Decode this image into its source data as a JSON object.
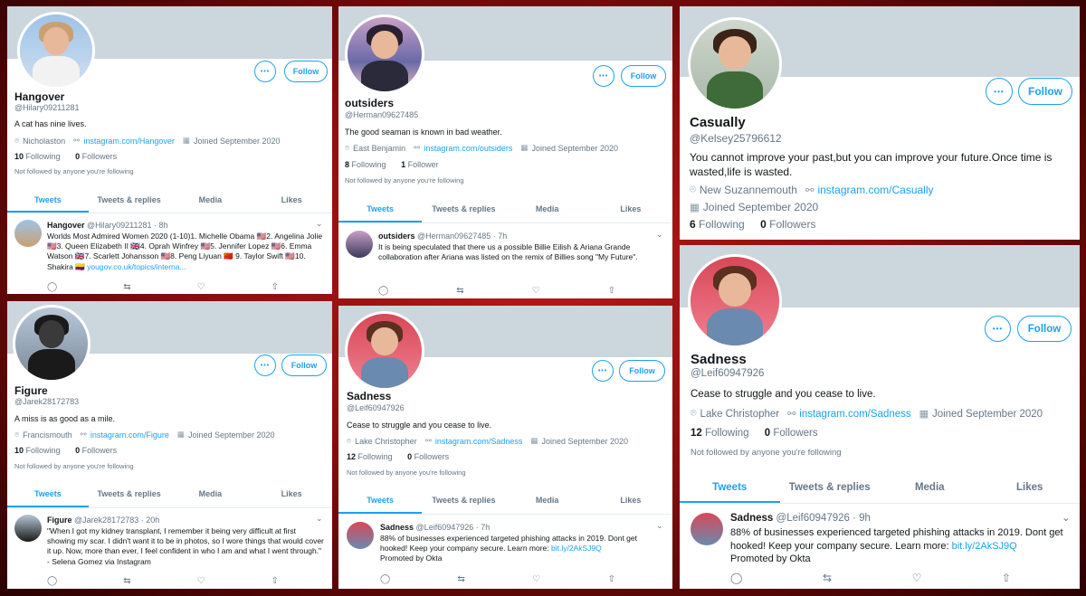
{
  "follow_label": "Follow",
  "more_label": "•••",
  "tabs": [
    "Tweets",
    "Tweets & replies",
    "Media",
    "Likes"
  ],
  "not_followed": "Not followed by anyone you're following",
  "icons": {
    "location": "location-pin-icon",
    "link": "link-icon",
    "calendar": "calendar-icon",
    "reply": "reply-icon",
    "retweet": "retweet-icon",
    "like": "heart-icon",
    "share": "share-icon",
    "chevron": "chevron-down-icon"
  },
  "colors": {
    "accent": "#1da1f2",
    "banner": "#ccd6dd",
    "muted": "#657786"
  },
  "cards": [
    {
      "name": "Hangover",
      "handle": "@Hilary09211281",
      "bio": "A cat has nine lives.",
      "location": "Nicholaston",
      "url": "instagram.com/Hangover",
      "joined": "Joined September 2020",
      "following": "10",
      "following_label": "Following",
      "followers": "0",
      "followers_label": "Followers",
      "tweet": {
        "name": "Hangover",
        "handle": "@Hilary09211281",
        "time": "· 8h",
        "text": "Worlds Most Admired Women 2020 (1-10)1. Michelle Obama 🇺🇸2. Angelina Jolie 🇺🇸3. Queen Elizabeth II 🇬🇧4. Oprah Winfrey 🇺🇸5. Jennifer Lopez 🇺🇸6. Emma Watson 🇬🇧7. Scarlett Johansson 🇺🇸8. Peng Liyuan 🇨🇳 9. Taylor Swift 🇺🇸10. Shakira 🇨🇴 ",
        "link": "yougov.co.uk/topics/interna..."
      }
    },
    {
      "name": "outsiders",
      "handle": "@Herman09627485",
      "bio": "The good seaman is known in bad weather.",
      "location": "East Benjamin",
      "url": "instagram.com/outsiders",
      "joined": "Joined September 2020",
      "following": "8",
      "following_label": "Following",
      "followers": "1",
      "followers_label": "Follower",
      "tweet": {
        "name": "outsiders",
        "handle": "@Herman09627485",
        "time": "· 7h",
        "text": "It is being speculated that there us a possible Billie Eilish & Ariana Grande collaboration after Ariana was listed on the remix of Billies song \"My Future\".",
        "link": ""
      }
    },
    {
      "name": "Casually",
      "handle": "@Kelsey25796612",
      "bio": "You cannot improve your past,but you can improve your future.Once time is wasted,life is wasted.",
      "location": "New Suzannemouth",
      "url": "instagram.com/Casually",
      "joined": "Joined September 2020",
      "following": "6",
      "following_label": "Following",
      "followers": "0",
      "followers_label": "Followers"
    },
    {
      "name": "Figure",
      "handle": "@Jarek28172783",
      "bio": "A miss is as good as a mile.",
      "location": "Francismouth",
      "url": "instagram.com/Figure",
      "joined": "Joined September 2020",
      "following": "10",
      "following_label": "Following",
      "followers": "0",
      "followers_label": "Followers",
      "tweet": {
        "name": "Figure",
        "handle": "@Jarek28172783",
        "time": "· 20h",
        "text": "\"When I got my kidney transplant, I remember it being very difficult at first showing my scar. I didn't want it to be in photos, so I wore things that would cover it up. Now, more than ever, I feel confident in who I am and what I went through.\" - Selena Gomez via Instagram",
        "link": ""
      }
    },
    {
      "name": "Sadness",
      "handle": "@Leif60947926",
      "bio": "Cease to struggle and you cease to live.",
      "location": "Lake Christopher",
      "url": "instagram.com/Sadness",
      "joined": "Joined September 2020",
      "following": "12",
      "following_label": "Following",
      "followers": "0",
      "followers_label": "Followers",
      "tweet": {
        "name": "Sadness",
        "handle": "@Leif60947926",
        "time": "· 7h",
        "text": "88% of businesses experienced targeted phishing attacks in 2019. Dont get hooked! Keep your company secure. Learn more: ",
        "link": "bit.ly/2AkSJ9Q",
        "promo": "Promoted by Okta"
      }
    },
    {
      "name": "Sadness",
      "handle": "@Leif60947926",
      "bio": "Cease to struggle and you cease to live.",
      "location": "Lake Christopher",
      "url": "instagram.com/Sadness",
      "joined": "Joined September 2020",
      "following": "12",
      "following_label": "Following",
      "followers": "0",
      "followers_label": "Followers",
      "tweet": {
        "name": "Sadness",
        "handle": "@Leif60947926",
        "time": "· 9h",
        "text": "88% of businesses experienced targeted phishing attacks in 2019. Dont get hooked! Keep your company secure. Learn more: ",
        "link": "bit.ly/2AkSJ9Q",
        "promo": "Promoted by Okta"
      }
    }
  ]
}
